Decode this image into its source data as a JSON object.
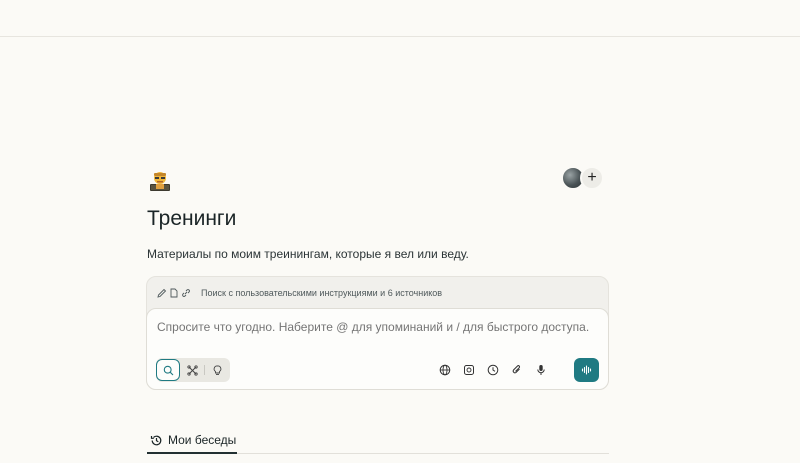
{
  "space": {
    "emoji": "🧑‍🏫",
    "title": "Тренинги",
    "description": "Материалы по моим треинингам, которые я вел или веду."
  },
  "members": {
    "add_label": "+"
  },
  "composer": {
    "hint": "Поиск с пользовательскими инструкциями и 6 источников",
    "placeholder": "Спросите что угодно. Наберите @ для упоминаний и / для быстрого доступа.",
    "modes": [
      "search-icon",
      "research-icon",
      "lightbulb-icon"
    ],
    "active_mode": "search",
    "tools": [
      "globe-icon",
      "image-icon",
      "clock-icon",
      "paperclip-icon",
      "microphone-icon"
    ],
    "accent_color": "#1f7a82"
  },
  "tabs": {
    "my_threads": "Мои беседы"
  }
}
